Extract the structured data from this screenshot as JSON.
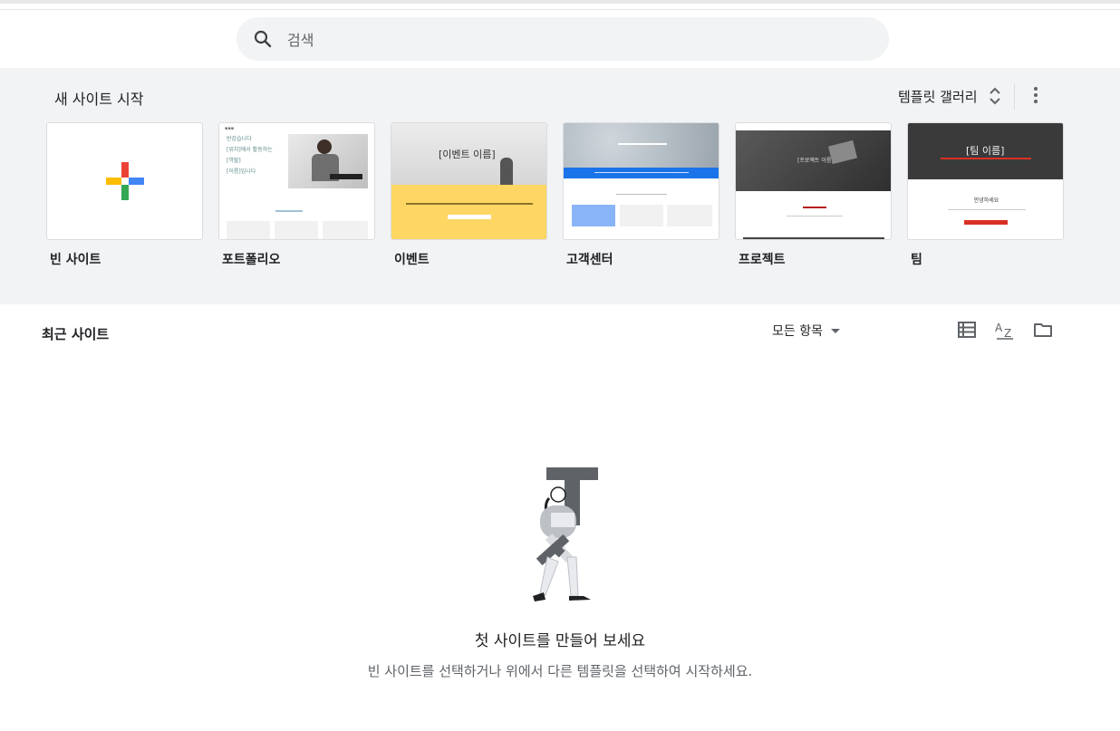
{
  "search": {
    "placeholder": "검색"
  },
  "gallery": {
    "title": "새 사이트 시작",
    "gallery_button": "템플릿 갤러리",
    "templates": [
      {
        "label": "빈 사이트"
      },
      {
        "label": "포트폴리오",
        "thumb_lines": [
          "반갑습니다",
          "[위치]에서 활동하는",
          "[역할]",
          "[이름]입니다"
        ]
      },
      {
        "label": "이벤트",
        "thumb_title": "[이벤트 이름]"
      },
      {
        "label": "고객센터"
      },
      {
        "label": "프로젝트",
        "thumb_title": "[프로젝트 이름]"
      },
      {
        "label": "팀",
        "thumb_title": "[팀 이름]",
        "thumb_sub": "안녕하세요"
      }
    ]
  },
  "recent": {
    "title": "최근 사이트",
    "filter_label": "모든 항목"
  },
  "empty_state": {
    "title": "첫 사이트를 만들어 보세요",
    "subtitle": "빈 사이트를 선택하거나 위에서 다른 템플릿을 선택하여 시작하세요."
  },
  "colors": {
    "google_red": "#ea4335",
    "google_blue": "#4285f4",
    "google_yellow": "#fbbc04",
    "google_green": "#34a853",
    "event_yellow": "#fdd663",
    "help_blue": "#1a73e8",
    "team_red": "#d93025"
  }
}
